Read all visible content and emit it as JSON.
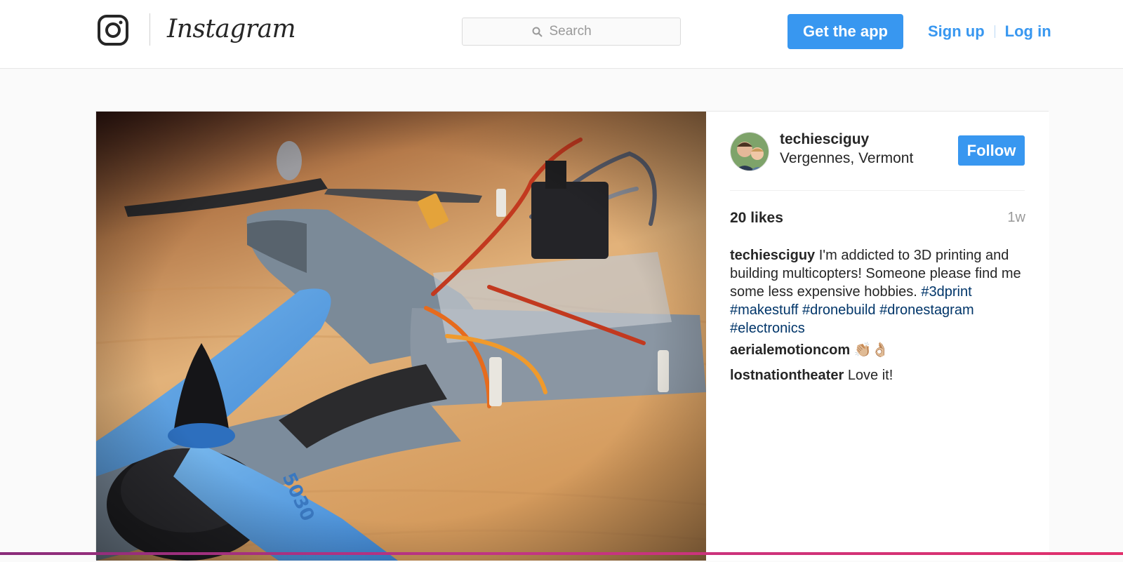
{
  "header": {
    "wordmark": "Instagram",
    "search_placeholder": "Search",
    "get_app_label": "Get the app",
    "signup_label": "Sign up",
    "login_label": "Log in"
  },
  "post": {
    "username": "techiesciguy",
    "location": "Vergennes, Vermont",
    "follow_label": "Follow",
    "likes": "20 likes",
    "time": "1w",
    "caption_user": "techiesciguy",
    "caption_text": "I'm addicted to 3D printing and building multicopters! Someone please find me some less expensive hobbies.",
    "hashtags": "#3dprint #makestuff #dronebuild #dronestagram #electronics",
    "comments": [
      {
        "user": "aerialemotioncom",
        "text": "👏🏼👌🏼"
      },
      {
        "user": "lostnationtheater",
        "text": "Love it!"
      }
    ],
    "photo_text": "5030"
  },
  "colors": {
    "accent": "#3897f0",
    "hashtag": "#003569",
    "muted": "#999999"
  },
  "icons": [
    "instagram-glyph-icon",
    "search-icon"
  ]
}
